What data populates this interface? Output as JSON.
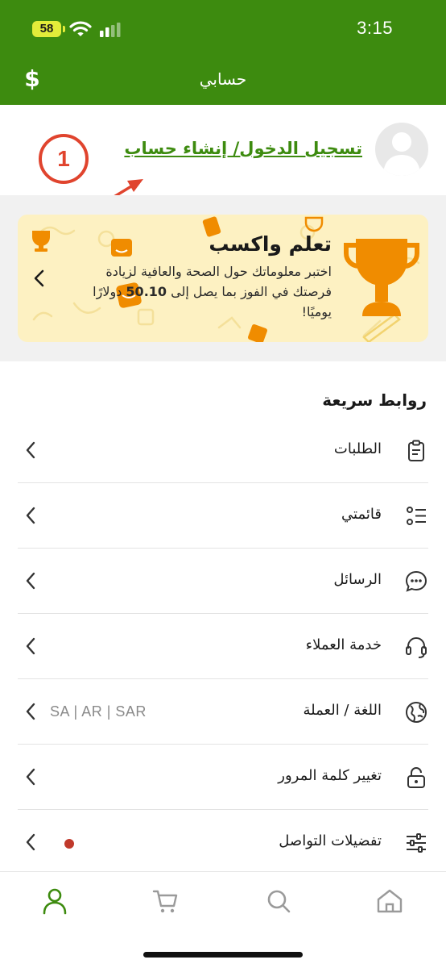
{
  "status_bar": {
    "battery": "58",
    "time": "3:15"
  },
  "header": {
    "title": "حسابي",
    "currency_icon": "dollar-icon",
    "background_color": "#3d8b0f"
  },
  "account": {
    "login_link": "تسجيل الدخول/ إنشاء حساب",
    "callout_number": "1",
    "avatar_icon": "user-placeholder-icon"
  },
  "promo": {
    "title": "تعلم واكسب",
    "body_line": "اختبر معلوماتك حول الصحة والعافية لزيادة فرصتك في الفوز بما يصل إلى",
    "amount": "50.10",
    "body_suffix": "دولارًا يوميًا!",
    "background_color": "#fdf1c2",
    "accent_color": "#f08c00"
  },
  "quick_links": {
    "title": "روابط سريعة",
    "items": [
      {
        "label": "الطلبات",
        "icon": "clipboard-icon"
      },
      {
        "label": "قائمتي",
        "icon": "list-icon"
      },
      {
        "label": "الرسائل",
        "icon": "chat-bubble-icon"
      },
      {
        "label": "خدمة العملاء",
        "icon": "headset-icon"
      },
      {
        "label": "اللغة / العملة",
        "icon": "globe-icon",
        "value": "SA | AR | SAR"
      },
      {
        "label": "تغيير كلمة المرور",
        "icon": "lock-icon"
      },
      {
        "label": "تفضيلات التواصل",
        "icon": "sliders-icon",
        "badge_color": "#c0392b"
      }
    ]
  },
  "bottom_nav": {
    "items": [
      {
        "icon": "user-icon",
        "active": true
      },
      {
        "icon": "cart-icon",
        "active": false
      },
      {
        "icon": "search-icon",
        "active": false
      },
      {
        "icon": "home-icon",
        "active": false
      }
    ],
    "active_color": "#3d8b0f",
    "inactive_color": "#9a9a9a"
  }
}
